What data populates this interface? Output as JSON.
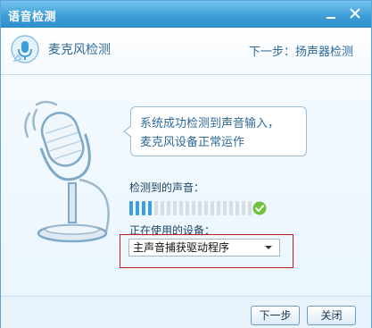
{
  "window": {
    "title": "语音检测"
  },
  "header": {
    "step_title": "麦克风检测",
    "next_step": "下一步：扬声器检测"
  },
  "bubble": {
    "line1": "系统成功检测到声音输入，",
    "line2": "麦克风设备正常运作"
  },
  "detection": {
    "label": "检测到的声音：",
    "level": 0.2,
    "status_icon": "check-circle-icon"
  },
  "device": {
    "label": "正在使用的设备：",
    "selected": "主声音捕获驱动程序"
  },
  "footer": {
    "next_label": "下一步",
    "close_label": "关闭"
  },
  "colors": {
    "accent": "#3f9ed8",
    "meter_active": "#3d9fe0",
    "meter_inactive": "#d8dde2",
    "ok": "#6fc23d",
    "highlight": "#c0201d"
  }
}
